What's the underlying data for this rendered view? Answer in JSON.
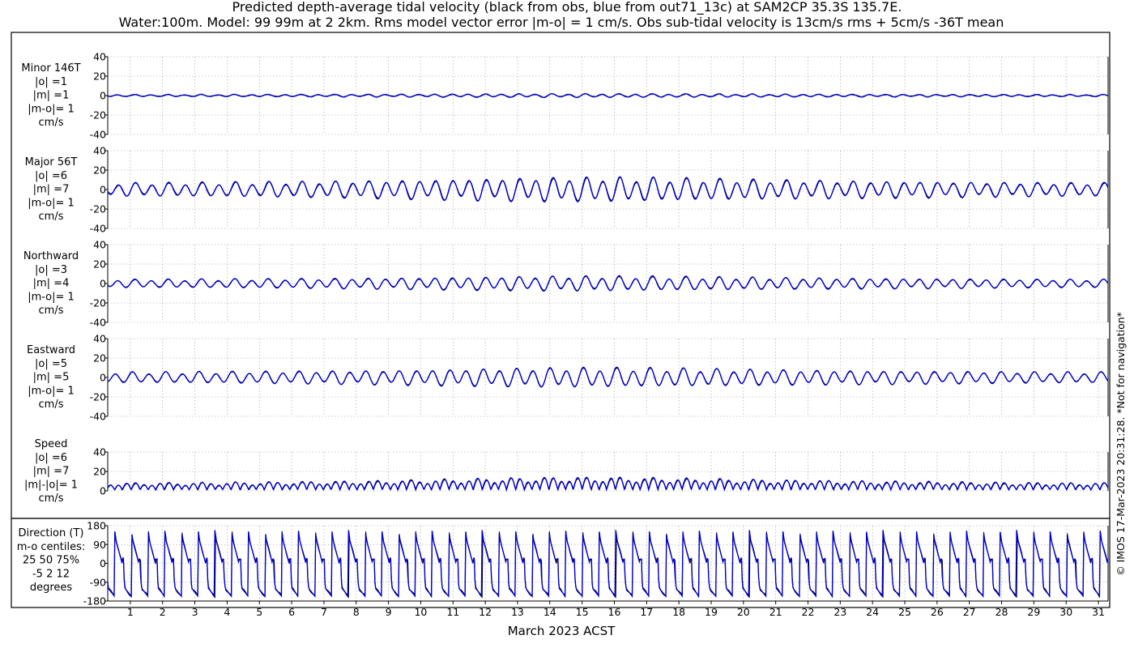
{
  "chart_data": {
    "type": "line",
    "title": [
      "Predicted depth-average tidal velocity (black from obs, blue from out71_13c) at SAM2CP 35.3S 135.7E.",
      "Water:100m. Model: 99 99m at 2 2km. Rms model vector error |m-o| = 1 cm/s. Obs sub-tidal velocity is 13cm/s rms + 5cm/s -36T mean"
    ],
    "xlabel": "March 2023 ACST",
    "xlim": [
      0.3,
      31.3
    ],
    "x_ticks": [
      "1",
      "2",
      "3",
      "4",
      "5",
      "6",
      "7",
      "8",
      "9",
      "10",
      "11",
      "12",
      "13",
      "14",
      "15",
      "16",
      "17",
      "18",
      "19",
      "20",
      "21",
      "22",
      "23",
      "24",
      "25",
      "26",
      "27",
      "28",
      "29",
      "30",
      "31"
    ],
    "copyright": "© IMOS 17-Mar-2023 20:31:28. *Not for navigation*",
    "series_colors": {
      "obs": "#000000",
      "model": "#0000cc"
    },
    "panels": [
      {
        "label_lines": [
          "Minor 146T",
          "|o| =1",
          "|m| =1",
          "|m-o|= 1",
          "cm/s"
        ],
        "ylim": [
          -40,
          40
        ],
        "y_ticks": [
          "40",
          "20",
          "0",
          "-20",
          "-40"
        ],
        "rms_obs": 1,
        "rms_model": 1,
        "rms_error": 1
      },
      {
        "label_lines": [
          "Major 56T",
          "|o| =6",
          "|m| =7",
          "|m-o|= 1",
          "cm/s"
        ],
        "ylim": [
          -40,
          40
        ],
        "y_ticks": [
          "40",
          "20",
          "0",
          "-20",
          "-40"
        ],
        "rms_obs": 6,
        "rms_model": 7,
        "rms_error": 1
      },
      {
        "label_lines": [
          "Northward",
          "|o| =3",
          "|m| =4",
          "|m-o|= 1",
          "cm/s"
        ],
        "ylim": [
          -40,
          40
        ],
        "y_ticks": [
          "40",
          "20",
          "0",
          "-20",
          "-40"
        ],
        "rms_obs": 3,
        "rms_model": 4,
        "rms_error": 1
      },
      {
        "label_lines": [
          "Eastward",
          "|o| =5",
          "|m| =5",
          "|m-o|= 1",
          "cm/s"
        ],
        "ylim": [
          -40,
          40
        ],
        "y_ticks": [
          "40",
          "20",
          "0",
          "-20",
          "-40"
        ],
        "rms_obs": 5,
        "rms_model": 5,
        "rms_error": 1
      },
      {
        "label_lines": [
          "Speed",
          "|o| =6",
          "|m| =7",
          "|m|-|o|= 1",
          "cm/s"
        ],
        "ylim": [
          0,
          40
        ],
        "y_ticks": [
          "40",
          "20",
          "0"
        ],
        "rms_obs": 6,
        "rms_model": 7,
        "rms_error": 1
      }
    ],
    "direction_panel": {
      "label_lines": [
        "Direction (T)",
        "m-o centiles:",
        "25  50  75%",
        "-5   2  12",
        "degrees"
      ],
      "ylim": [
        -180,
        180
      ],
      "y_ticks": [
        "180",
        "90",
        "0",
        "-90",
        "-180"
      ],
      "centiles": [
        -5,
        2,
        12
      ]
    },
    "grid": "dotted"
  }
}
